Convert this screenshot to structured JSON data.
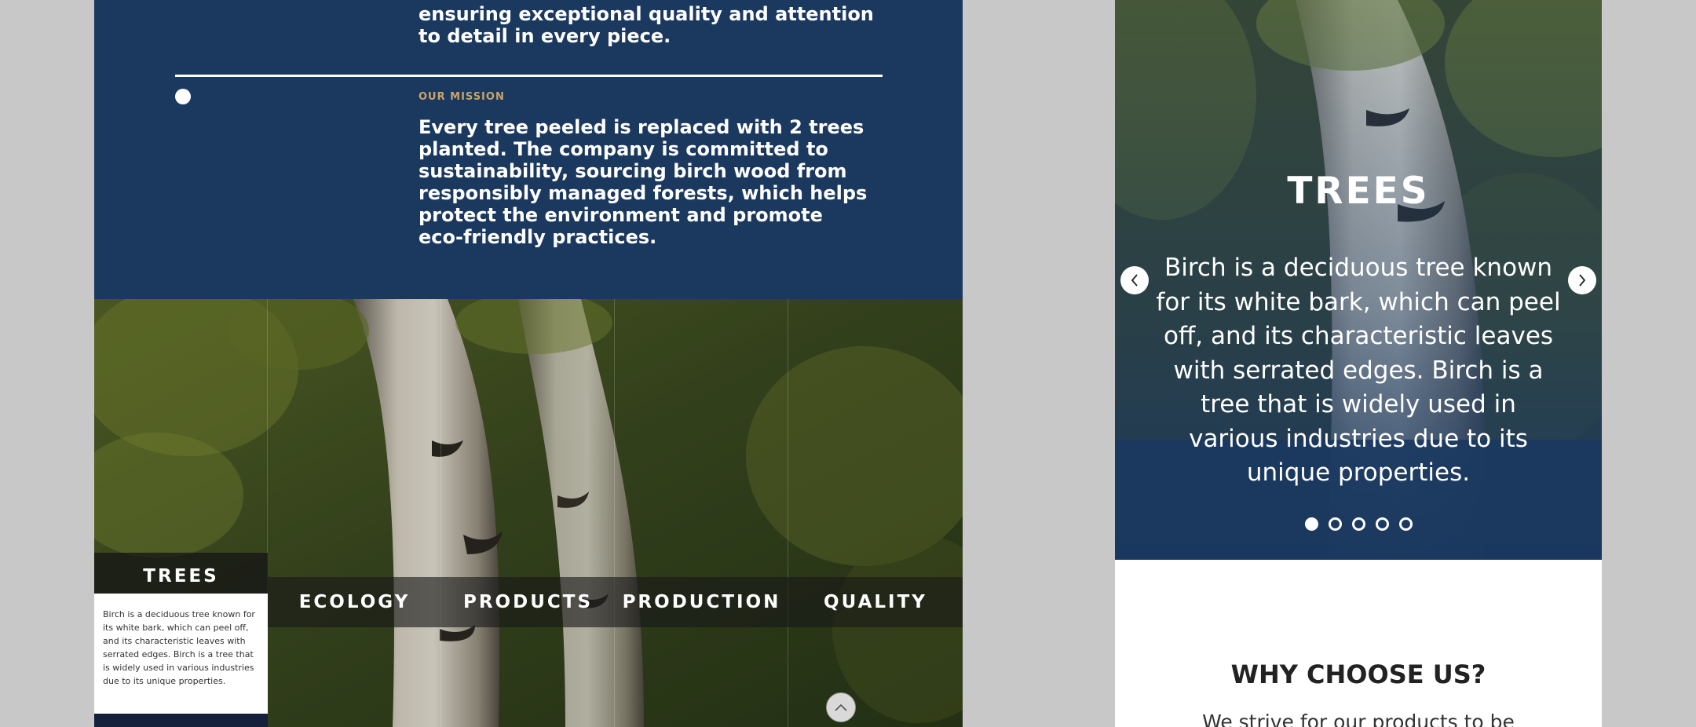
{
  "about": {
    "quality_text": "ensuring exceptional quality and attention to detail in every piece.",
    "mission_label": "OUR MISSION",
    "mission_text": "Every tree peeled is replaced with 2 trees planted. The company is committed to sustainability, sourcing birch wood from responsibly managed forests, which helps protect the environment and promote eco-friendly practices."
  },
  "categories": {
    "trees": {
      "label": "TREES",
      "description": "Birch is a deciduous tree known for its white bark, which can peel off, and its characteristic leaves with serrated edges. Birch is a tree that is widely used in various industries due to its unique properties."
    },
    "ecology": {
      "label": "ECOLOGY"
    },
    "products": {
      "label": "PRODUCTS"
    },
    "production": {
      "label": "PRODUCTION"
    },
    "quality": {
      "label": "QUALITY"
    }
  },
  "slider": {
    "title": "TREES",
    "text": "Birch is a deciduous tree known for its white bark, which can peel off, and its characteristic leaves with serrated edges. Birch is a tree that is widely used in various industries due to its unique properties.",
    "dots": 5,
    "active_index": 0
  },
  "why": {
    "title": "WHY CHOOSE US?",
    "text": "We strive for our products to be synonymous with"
  },
  "colors": {
    "navy": "#1b385f",
    "gold": "#c9a46a",
    "dark_overlay": "#191919"
  },
  "icons": {
    "prev": "chevron-left-icon",
    "next": "chevron-right-icon",
    "scroll_top": "chevron-up-icon"
  }
}
